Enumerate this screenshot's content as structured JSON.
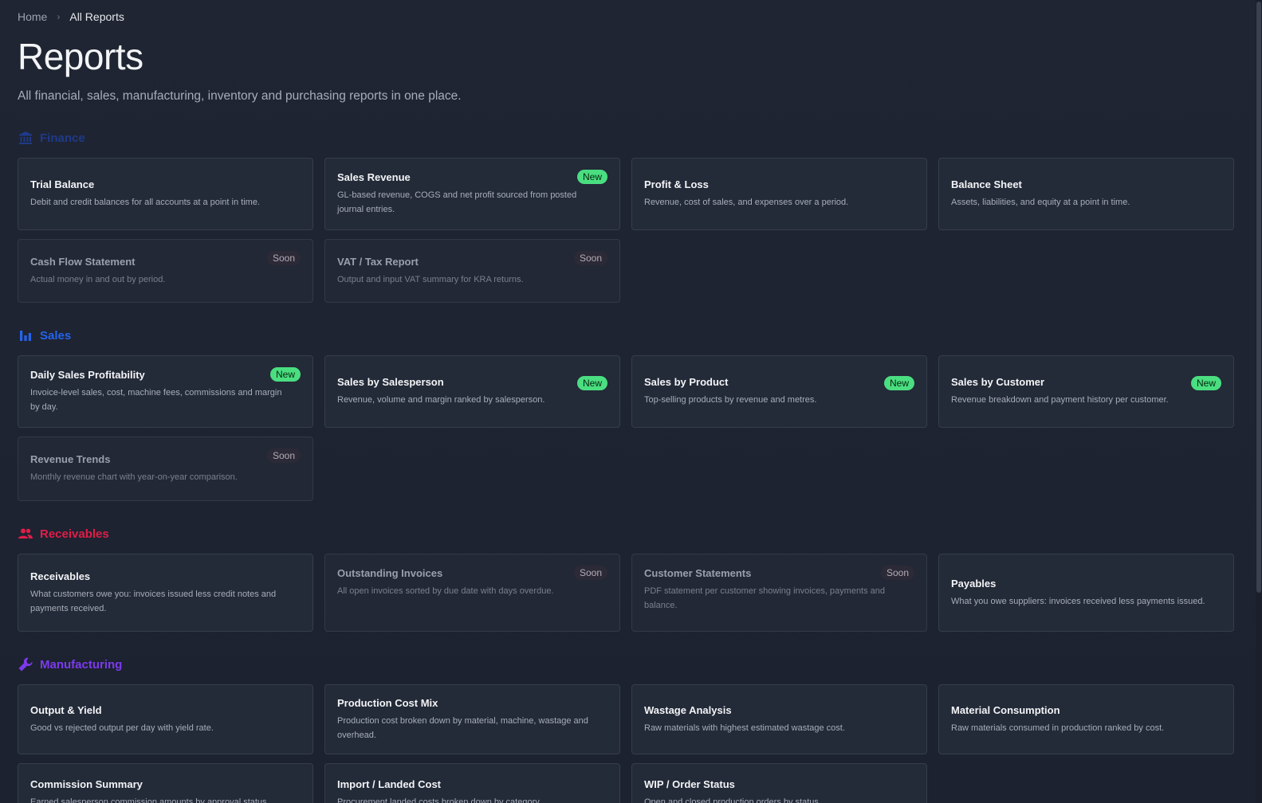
{
  "breadcrumb": {
    "home": "Home",
    "current": "All Reports"
  },
  "title": "Reports",
  "subtitle": "All financial, sales, manufacturing, inventory and purchasing reports in one place.",
  "colors": {
    "finance": "#1e3a8a",
    "sales": "#2563eb",
    "receivables": "#e11d48",
    "manufacturing": "#7c3aed",
    "new_badge": "#4ade80"
  },
  "sections": [
    {
      "name": "Finance",
      "icon": "bank-icon",
      "cards": [
        {
          "title": "Trial Balance",
          "desc": "Debit and credit balances for all accounts at a point in time.",
          "badge": ""
        },
        {
          "title": "Sales Revenue",
          "desc": "GL-based revenue, COGS and net profit sourced from posted journal entries.",
          "badge": "New"
        },
        {
          "title": "Profit & Loss",
          "desc": "Revenue, cost of sales, and expenses over a period.",
          "badge": ""
        },
        {
          "title": "Balance Sheet",
          "desc": "Assets, liabilities, and equity at a point in time.",
          "badge": ""
        },
        {
          "title": "Cash Flow Statement",
          "desc": "Actual money in and out by period.",
          "badge": "Soon"
        },
        {
          "title": "VAT / Tax Report",
          "desc": "Output and input VAT summary for KRA returns.",
          "badge": "Soon"
        }
      ]
    },
    {
      "name": "Sales",
      "icon": "bar-chart-icon",
      "cards": [
        {
          "title": "Daily Sales Profitability",
          "desc": "Invoice-level sales, cost, machine fees, commissions and margin by day.",
          "badge": "New"
        },
        {
          "title": "Sales by Salesperson",
          "desc": "Revenue, volume and margin ranked by salesperson.",
          "badge": "New"
        },
        {
          "title": "Sales by Product",
          "desc": "Top-selling products by revenue and metres.",
          "badge": "New"
        },
        {
          "title": "Sales by Customer",
          "desc": "Revenue breakdown and payment history per customer.",
          "badge": "New"
        },
        {
          "title": "Revenue Trends",
          "desc": "Monthly revenue chart with year-on-year comparison.",
          "badge": "Soon"
        }
      ]
    },
    {
      "name": "Receivables",
      "icon": "people-icon",
      "cards": [
        {
          "title": "Receivables",
          "desc": "What customers owe you: invoices issued less credit notes and payments received.",
          "badge": ""
        },
        {
          "title": "Outstanding Invoices",
          "desc": "All open invoices sorted by due date with days overdue.",
          "badge": "Soon"
        },
        {
          "title": "Customer Statements",
          "desc": "PDF statement per customer showing invoices, payments and balance.",
          "badge": "Soon"
        },
        {
          "title": "Payables",
          "desc": "What you owe suppliers: invoices received less payments issued.",
          "badge": ""
        }
      ]
    },
    {
      "name": "Manufacturing",
      "icon": "wrench-icon",
      "cards": [
        {
          "title": "Output & Yield",
          "desc": "Good vs rejected output per day with yield rate.",
          "badge": ""
        },
        {
          "title": "Production Cost Mix",
          "desc": "Production cost broken down by material, machine, wastage and overhead.",
          "badge": ""
        },
        {
          "title": "Wastage Analysis",
          "desc": "Raw materials with highest estimated wastage cost.",
          "badge": ""
        },
        {
          "title": "Material Consumption",
          "desc": "Raw materials consumed in production ranked by cost.",
          "badge": ""
        },
        {
          "title": "Commission Summary",
          "desc": "Earned salesperson commission amounts by approval status.",
          "badge": ""
        },
        {
          "title": "Import / Landed Cost",
          "desc": "Procurement landed costs broken down by category.",
          "badge": ""
        },
        {
          "title": "WIP / Order Status",
          "desc": "Open and closed production orders by status.",
          "badge": ""
        }
      ]
    }
  ]
}
